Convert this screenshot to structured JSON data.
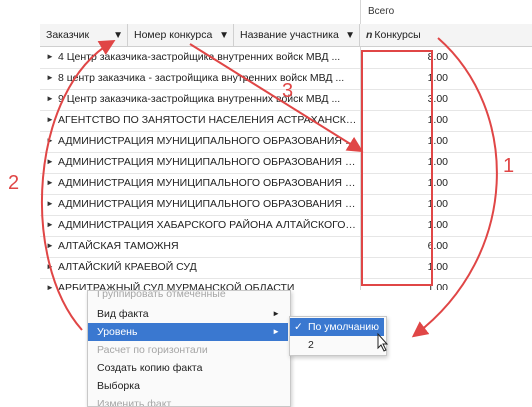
{
  "pivot": {
    "total_label": "Всего",
    "columns": [
      {
        "label": "Заказчик",
        "prefix": ""
      },
      {
        "label": "Номер конкурса",
        "prefix": ""
      },
      {
        "label": "Название участника",
        "prefix": ""
      },
      {
        "label": "Конкурсы",
        "prefix": "n"
      }
    ],
    "rows": [
      {
        "name": "4 Центр заказчика-застройщика внутренних войск МВД ...",
        "value": "8.00"
      },
      {
        "name": "8 центр заказчика - застройщика внутренних войск МВД ...",
        "value": "1.00"
      },
      {
        "name": "9 Центр заказчика-застройщика внутренних войск МВД ...",
        "value": "3.00"
      },
      {
        "name": "АГЕНТСТВО ПО ЗАНЯТОСТИ НАСЕЛЕНИЯ АСТРАХАНСКОЙ ...",
        "value": "1.00"
      },
      {
        "name": "АДМИНИСТРАЦИЯ МУНИЦИПАЛЬНОГО ОБРАЗОВАНИЯ Г...",
        "value": "1.00"
      },
      {
        "name": "АДМИНИСТРАЦИЯ МУНИЦИПАЛЬНОГО ОБРАЗОВАНИЯ Л...",
        "value": "1.00"
      },
      {
        "name": "АДМИНИСТРАЦИЯ МУНИЦИПАЛЬНОГО ОБРАЗОВАНИЯ Н...",
        "value": "1.00"
      },
      {
        "name": "АДМИНИСТРАЦИЯ МУНИЦИПАЛЬНОГО ОБРАЗОВАНИЯ С...",
        "value": "1.00"
      },
      {
        "name": "АДМИНИСТРАЦИЯ ХАБАРСКОГО РАЙОНА АЛТАЙСКОГО К...",
        "value": "1.00"
      },
      {
        "name": "АЛТАЙСКАЯ ТАМОЖНЯ",
        "value": "6.00"
      },
      {
        "name": "АЛТАЙСКИЙ КРАЕВОЙ СУД",
        "value": "1.00"
      },
      {
        "name": "АРБИТРАЖНЫЙ СУД МУРМАНСКОЙ ОБЛАСТИ",
        "value": "1.00"
      }
    ]
  },
  "context_menu": {
    "items": [
      {
        "label": "Группировать отмеченные",
        "disabled": true,
        "submenu": false
      },
      {
        "label": "Вид факта",
        "disabled": false,
        "submenu": true
      },
      {
        "label": "Уровень",
        "disabled": false,
        "submenu": true,
        "selected": true
      },
      {
        "label": "Расчет по горизонтали",
        "disabled": true,
        "submenu": false
      },
      {
        "label": "Создать копию факта",
        "disabled": false,
        "submenu": false
      },
      {
        "label": "Выборка",
        "disabled": false,
        "submenu": false
      },
      {
        "label": "Изменить факт",
        "disabled": true,
        "submenu": false
      }
    ]
  },
  "level_submenu": {
    "items": [
      {
        "label": "По умолчанию",
        "checked": true
      },
      {
        "label": "2",
        "checked": false
      }
    ]
  },
  "annotations": {
    "one": "1",
    "two": "2",
    "three": "3"
  },
  "colors": {
    "annotation": "#e04646",
    "selection": "#3a78d0"
  }
}
